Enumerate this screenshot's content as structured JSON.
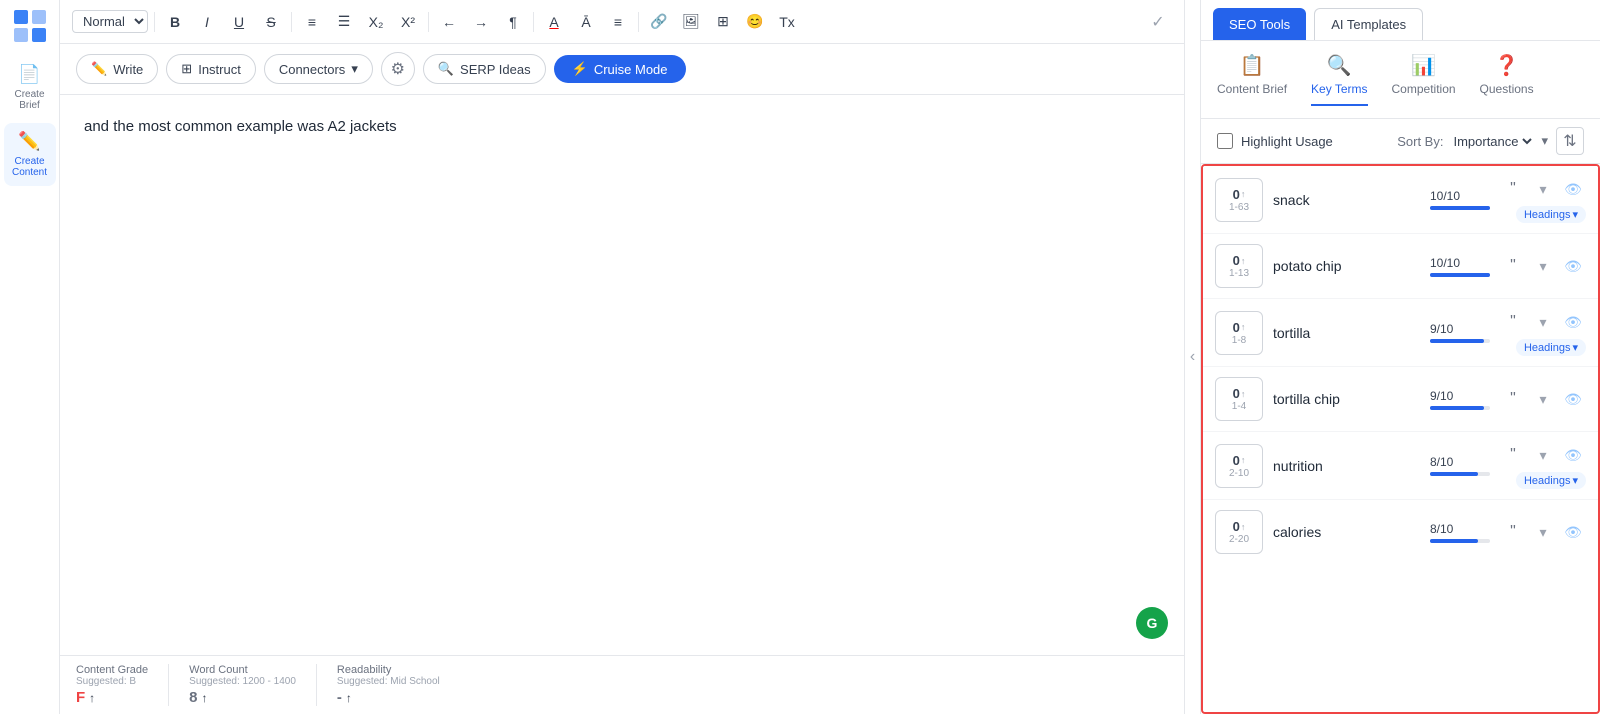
{
  "sidebar": {
    "items": [
      {
        "id": "create-brief",
        "label": "Create Brief",
        "icon": "📄",
        "active": false
      },
      {
        "id": "create-content",
        "label": "Create Content",
        "icon": "✏️",
        "active": true
      }
    ]
  },
  "toolbar": {
    "format_select": "Normal",
    "buttons": [
      "B",
      "I",
      "U",
      "S",
      "OL",
      "UL",
      "X₂",
      "X²",
      "←",
      "→",
      "¶",
      "A",
      "Ā",
      "≡",
      "🔗",
      "🖼",
      "⊞",
      "😊",
      "Tx"
    ]
  },
  "action_bar": {
    "write_label": "Write",
    "instruct_label": "Instruct",
    "connectors_label": "Connectors",
    "settings_label": "⚙",
    "serp_label": "SERP Ideas",
    "cruise_label": "Cruise Mode"
  },
  "editor": {
    "content": "and the most common example was A2 jackets"
  },
  "status_bar": {
    "grade_label": "Content Grade",
    "grade_sub": "Suggested: B",
    "grade_value": "F",
    "grade_arrow": "↑",
    "wordcount_label": "Word Count",
    "wordcount_sub": "Suggested: 1200 - 1400",
    "wordcount_value": "8",
    "wordcount_arrow": "↑",
    "readability_label": "Readability",
    "readability_sub": "Suggested: Mid School",
    "readability_value": "-",
    "readability_arrow": "↑"
  },
  "right_panel": {
    "seo_tab": "SEO Tools",
    "ai_tab": "AI Templates",
    "nav_items": [
      {
        "id": "content-brief",
        "label": "Content Brief",
        "icon": "📋"
      },
      {
        "id": "key-terms",
        "label": "Key Terms",
        "icon": "🔍",
        "active": true
      },
      {
        "id": "competition",
        "label": "Competition",
        "icon": "📊"
      },
      {
        "id": "questions",
        "label": "Questions",
        "icon": "❓"
      }
    ],
    "highlight_label": "Highlight Usage",
    "sort_label": "Sort By:",
    "sort_value": "Importance",
    "key_terms": [
      {
        "id": "snack",
        "count": "0",
        "arrow": "↑",
        "range": "1-63",
        "name": "snack",
        "score": "10/10",
        "bar_pct": 100,
        "headings": true
      },
      {
        "id": "potato-chip",
        "count": "0",
        "arrow": "↑",
        "range": "1-13",
        "name": "potato chip",
        "score": "10/10",
        "bar_pct": 100,
        "headings": false
      },
      {
        "id": "tortilla",
        "count": "0",
        "arrow": "↑",
        "range": "1-8",
        "name": "tortilla",
        "score": "9/10",
        "bar_pct": 90,
        "headings": true
      },
      {
        "id": "tortilla-chip",
        "count": "0",
        "arrow": "↑",
        "range": "1-4",
        "name": "tortilla chip",
        "score": "9/10",
        "bar_pct": 90,
        "headings": false
      },
      {
        "id": "nutrition",
        "count": "0",
        "arrow": "↑",
        "range": "2-10",
        "name": "nutrition",
        "score": "8/10",
        "bar_pct": 80,
        "headings": true
      },
      {
        "id": "calories",
        "count": "0",
        "arrow": "↑",
        "range": "2-20",
        "name": "calories",
        "score": "8/10",
        "bar_pct": 80,
        "headings": false
      }
    ],
    "headings_label": "Headings"
  }
}
